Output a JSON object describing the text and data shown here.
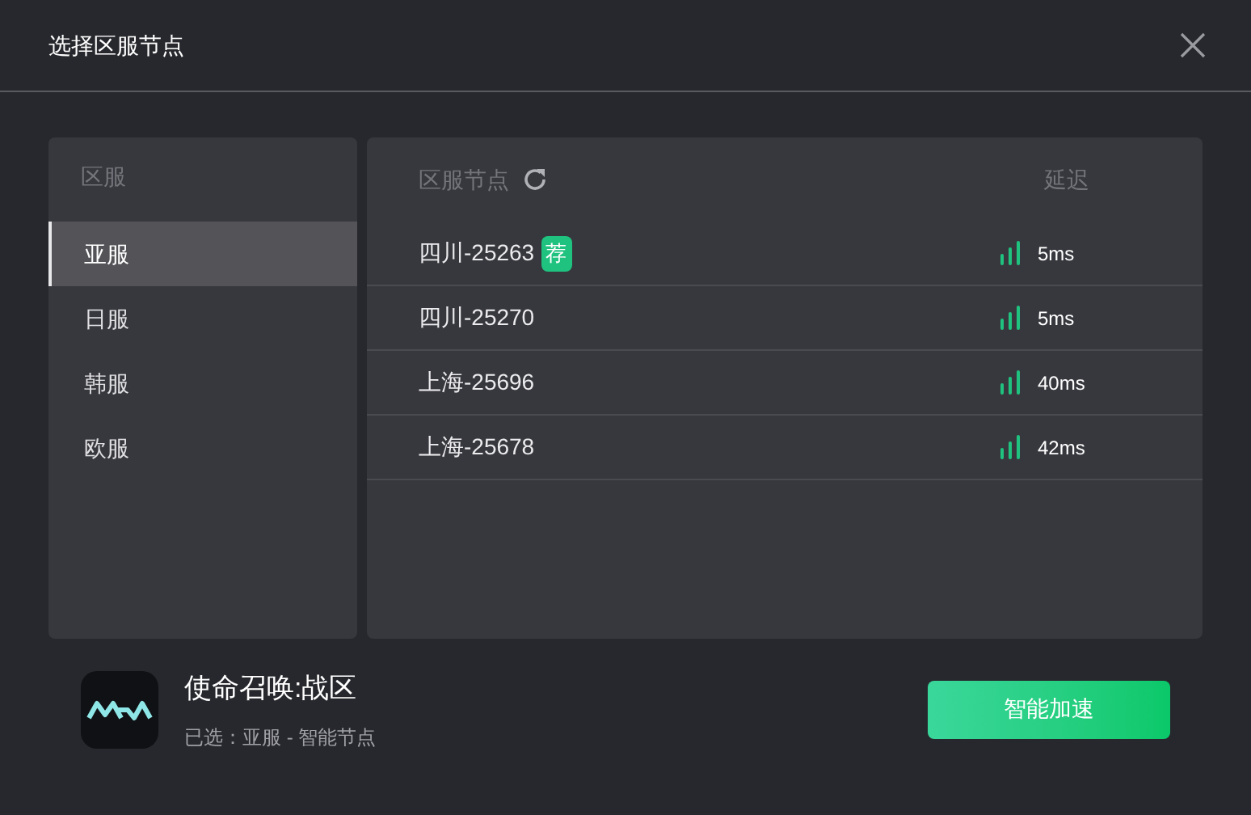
{
  "window": {
    "title": "选择区服节点"
  },
  "regions": {
    "heading": "区服",
    "items": [
      {
        "label": "亚服",
        "selected": true
      },
      {
        "label": "日服",
        "selected": false
      },
      {
        "label": "韩服",
        "selected": false
      },
      {
        "label": "欧服",
        "selected": false
      }
    ]
  },
  "nodes": {
    "columns": [
      "区服节点",
      "延迟"
    ],
    "rows": [
      {
        "name": "四川-25263",
        "badge": "荐",
        "latency": "5ms"
      },
      {
        "name": "四川-25270",
        "latency": "5ms"
      },
      {
        "name": "上海-25696",
        "latency": "40ms"
      },
      {
        "name": "上海-25678",
        "latency": "42ms"
      }
    ]
  },
  "game": {
    "title": "使命召唤:战区",
    "selection": "已选：亚服 - 智能节点"
  },
  "button": "智能加速"
}
